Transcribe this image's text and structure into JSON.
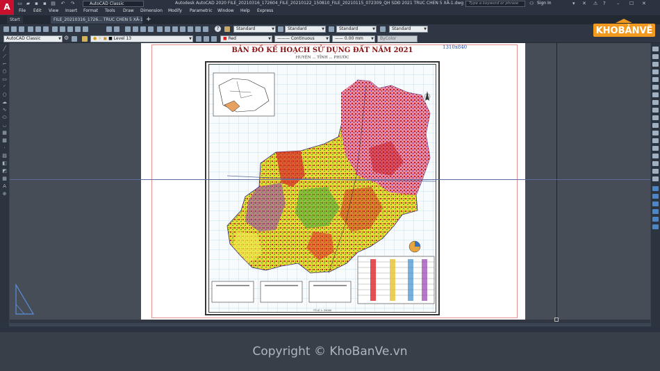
{
  "titlebar": {
    "workspace": "AutoCAD Classic",
    "title": "Autodesk AutoCAD 2020   FILE_20210316_172604_FILE_20210122_150810_FILE_20210115_072309_QH SDĐ 2021 TRUC CHEN 5 XÃ-1.dwg",
    "search_placeholder": "Type a keyword or phrase",
    "signin": "Sign In"
  },
  "menu": [
    "File",
    "Edit",
    "View",
    "Insert",
    "Format",
    "Tools",
    "Draw",
    "Dimension",
    "Modify",
    "Parametric",
    "Window",
    "Help",
    "Express"
  ],
  "tabs": {
    "start": "Start",
    "file": "FILE_20210316_1726... TRUC CHEN 5 XÃ-1*",
    "add": "+"
  },
  "toolbar1": {
    "text_style": "Standard",
    "dim_style": "Standard",
    "table_style": "Standard",
    "mleader_style": "Standard"
  },
  "toolbar2": {
    "workspace": "AutoCAD Classic",
    "layer": "Level 13",
    "color": "Red",
    "linetype": "Continuous",
    "lineweight": "0.00 mm",
    "plotstyle": "ByColor"
  },
  "drawing": {
    "title": "BẢN ĐỒ KẾ HOẠCH SỬ DỤNG ĐẤT NĂM 2021",
    "subtitle": "HUYỆN ... TỈNH ... PHƯỚC",
    "size_label": "1310x840",
    "scale": "TỶ LỆ 1: 25000"
  },
  "footer": {
    "copyright": "Copyright © KhoBanVe.vn",
    "logo_text": "KHOBẢNVẼ"
  },
  "colors": {
    "accent": "#c8102e",
    "background": "#3b4452",
    "paper": "#ffffff",
    "logo_orange": "#f29a1f"
  }
}
